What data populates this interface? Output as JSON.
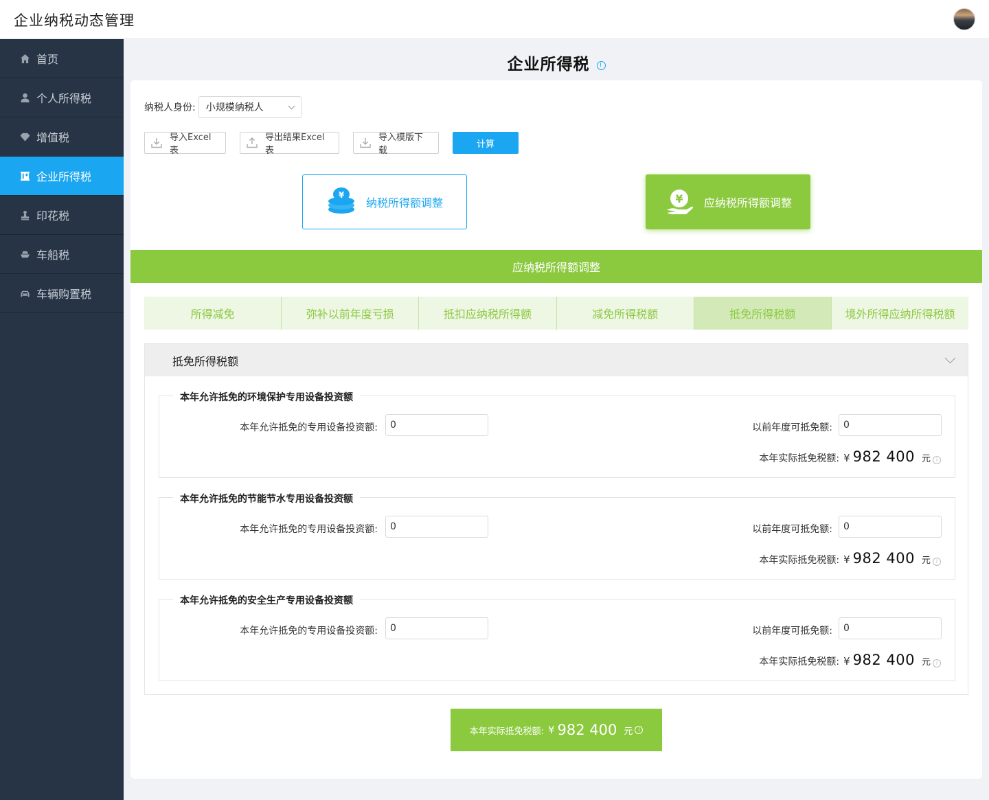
{
  "app": {
    "title": "企业纳税动态管理"
  },
  "sidebar": {
    "items": [
      {
        "label": "首页",
        "icon": "home-icon"
      },
      {
        "label": "个人所得税",
        "icon": "user-icon"
      },
      {
        "label": "增值税",
        "icon": "diamond-icon"
      },
      {
        "label": "企业所得税",
        "icon": "building-icon",
        "active": true
      },
      {
        "label": "印花税",
        "icon": "stamp-icon"
      },
      {
        "label": "车船税",
        "icon": "ship-icon"
      },
      {
        "label": "车辆购置税",
        "icon": "car-icon"
      }
    ]
  },
  "page": {
    "title": "企业所得税",
    "info_glyph": "i"
  },
  "form": {
    "taxpayer_label": "纳税人身份:",
    "taxpayer_value": "小规模纳税人"
  },
  "toolbar": {
    "import_excel": "导入Excel表",
    "export_excel": "导出结果Excel表",
    "template_download": "导入模版下载",
    "calculate": "计算"
  },
  "options": {
    "opt1": "纳税所得额调整",
    "opt2": "应纳税所得额调整"
  },
  "section_bar": "应纳税所得额调整",
  "tabs": [
    {
      "label": "所得减免"
    },
    {
      "label": "弥补以前年度亏损"
    },
    {
      "label": "抵扣应纳税所得额"
    },
    {
      "label": "减免所得税额"
    },
    {
      "label": "抵免所得税额",
      "active": true
    },
    {
      "label": "境外所得应纳所得税额"
    }
  ],
  "panel": {
    "title": "抵免所得税额",
    "groups": [
      {
        "title": "本年允许抵免的环境保护专用设备投资额",
        "field1_label": "本年允许抵免的专用设备投资额:",
        "field1_value": "0",
        "field2_label": "以前年度可抵免额:",
        "field2_value": "0",
        "result_label": "本年实际抵免税额:",
        "currency": "¥",
        "result_amount": "982 400",
        "unit": "元"
      },
      {
        "title": "本年允许抵免的节能节水专用设备投资额",
        "field1_label": "本年允许抵免的专用设备投资额:",
        "field1_value": "0",
        "field2_label": "以前年度可抵免额:",
        "field2_value": "0",
        "result_label": "本年实际抵免税额:",
        "currency": "¥",
        "result_amount": "982 400",
        "unit": "元"
      },
      {
        "title": "本年允许抵免的安全生产专用设备投资额",
        "field1_label": "本年允许抵免的专用设备投资额:",
        "field1_value": "0",
        "field2_label": "以前年度可抵免额:",
        "field2_value": "0",
        "result_label": "本年实际抵免税额:",
        "currency": "¥",
        "result_amount": "982 400",
        "unit": "元"
      }
    ]
  },
  "total": {
    "label": "本年实际抵免税额:",
    "currency": "¥",
    "amount": "982 400",
    "unit": "元"
  },
  "colors": {
    "sidebar_bg": "#263445",
    "accent_blue": "#1aa6f0",
    "accent_green": "#8bc93f"
  }
}
